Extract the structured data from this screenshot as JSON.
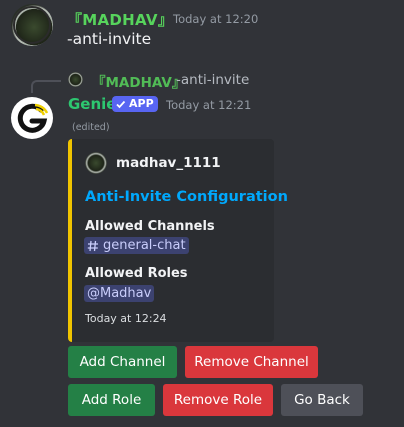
{
  "messages": [
    {
      "author": "『MADHAV』",
      "timestamp": "Today at 12:20",
      "content": "-anti-invite"
    },
    {
      "reply": {
        "author": "『MADHAV』",
        "content": "-anti-invite"
      },
      "author": "Genie",
      "badge": "APP",
      "timestamp": "Today at 12:21",
      "edited": "(edited)",
      "embed": {
        "accent_color": "#f0c400",
        "author": "madhav_1111",
        "title": "Anti-Invite Configuration",
        "fields": [
          {
            "name": "Allowed Channels",
            "value": "general-chat",
            "value_icon": "hash-icon"
          },
          {
            "name": "Allowed Roles",
            "value": "@Madhav"
          }
        ],
        "footer": "Today at 12:24"
      },
      "buttons": [
        {
          "label": "Add Channel",
          "style": "success"
        },
        {
          "label": "Remove Channel",
          "style": "danger"
        },
        {
          "label": "Add Role",
          "style": "success"
        },
        {
          "label": "Remove Role",
          "style": "danger"
        },
        {
          "label": "Go Back",
          "style": "secondary"
        }
      ]
    }
  ],
  "colors": {
    "background": "#313338",
    "embed_background": "#2b2d31",
    "username_green": "#57d45c",
    "bot_name": "#2dc770",
    "link_blue": "#00a8fc",
    "success": "#248046",
    "danger": "#da373c",
    "secondary": "#4e5058",
    "app_badge": "#5865f2"
  }
}
